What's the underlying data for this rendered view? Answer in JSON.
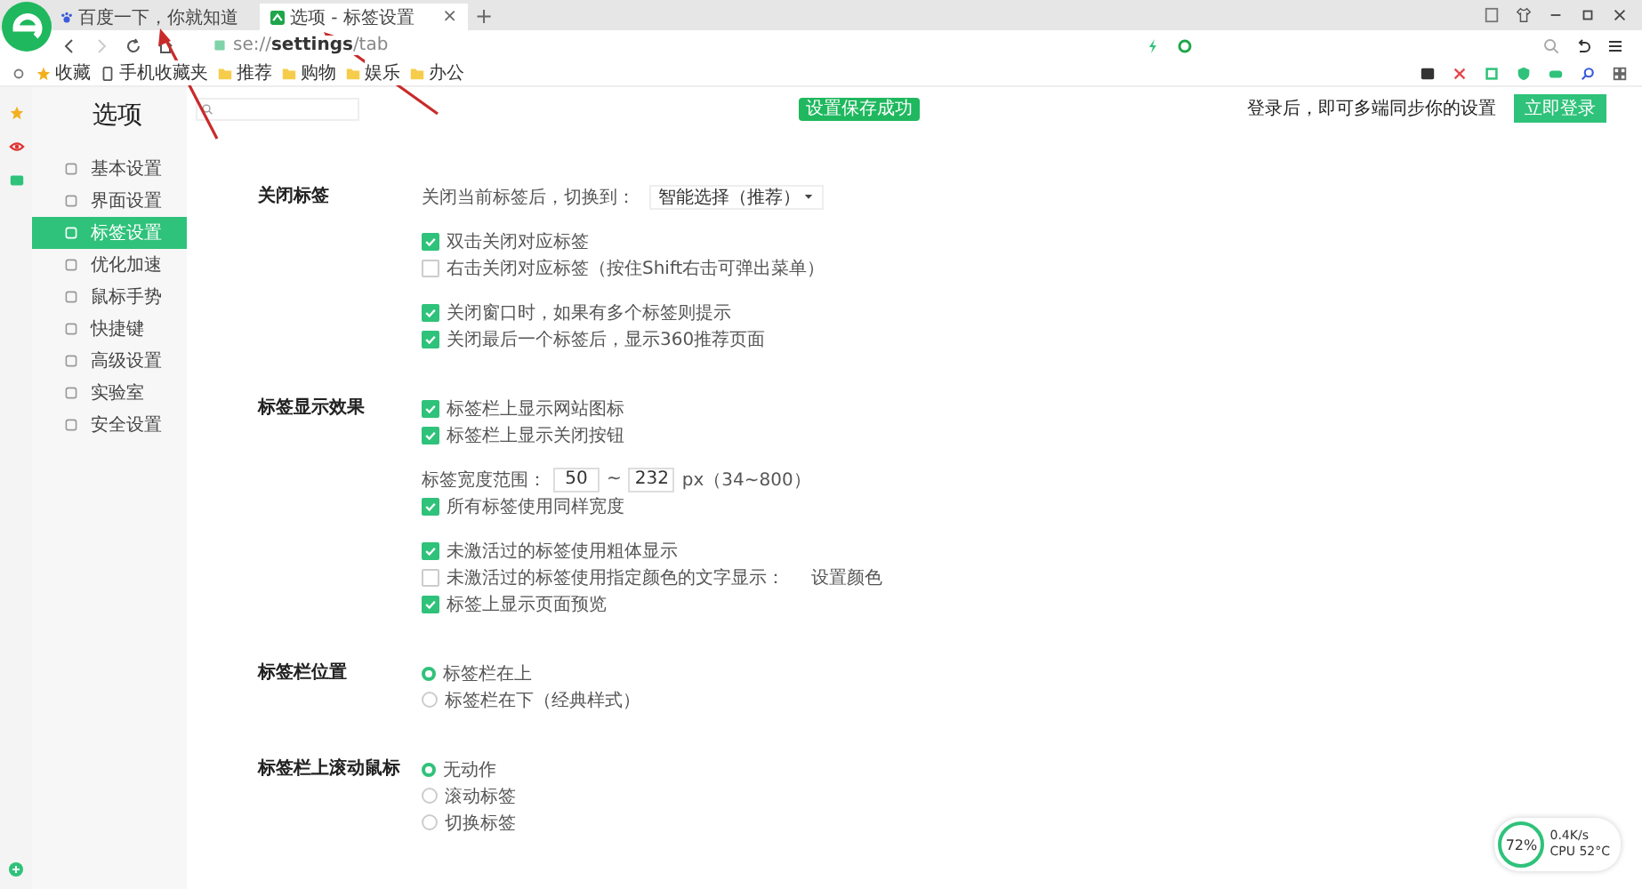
{
  "browser": {
    "tabs": [
      {
        "title": "百度一下，你就知道",
        "selected": false
      },
      {
        "title": "选项 - 标签设置",
        "selected": true
      }
    ],
    "tab_close": "×",
    "new_tab": "+",
    "address": "se://**settings**/tab",
    "bookmarks": [
      {
        "label": "收藏",
        "kind": "star"
      },
      {
        "label": "手机收藏夹",
        "kind": "phone"
      },
      {
        "label": "推荐",
        "kind": "folder"
      },
      {
        "label": "购物",
        "kind": "folder"
      },
      {
        "label": "娱乐",
        "kind": "folder"
      },
      {
        "label": "办公",
        "kind": "folder"
      }
    ]
  },
  "page": {
    "title": "选项",
    "toast": "设置保存成功",
    "sync_hint": "登录后，即可多端同步你的设置",
    "login_button": "立即登录"
  },
  "sidebar": {
    "items": [
      {
        "label": "基本设置",
        "selected": false
      },
      {
        "label": "界面设置",
        "selected": false
      },
      {
        "label": "标签设置",
        "selected": true
      },
      {
        "label": "优化加速",
        "selected": false
      },
      {
        "label": "鼠标手势",
        "selected": false
      },
      {
        "label": "快捷键",
        "selected": false
      },
      {
        "label": "高级设置",
        "selected": false
      },
      {
        "label": "实验室",
        "selected": false
      },
      {
        "label": "安全设置",
        "selected": false
      }
    ]
  },
  "sections": [
    {
      "title": "关闭标签",
      "groups": [
        [
          {
            "kind": "select",
            "label": "关闭当前标签后，切换到：",
            "value": "智能选择（推荐）"
          }
        ],
        [
          {
            "kind": "checkbox",
            "label": "双击关闭对应标签",
            "checked": true
          },
          {
            "kind": "checkbox",
            "label": "右击关闭对应标签（按住Shift右击可弹出菜单）",
            "checked": false
          }
        ],
        [
          {
            "kind": "checkbox",
            "label": "关闭窗口时，如果有多个标签则提示",
            "checked": true
          },
          {
            "kind": "checkbox",
            "label": "关闭最后一个标签后，显示360推荐页面",
            "checked": true
          }
        ]
      ]
    },
    {
      "title": "标签显示效果",
      "groups": [
        [
          {
            "kind": "checkbox",
            "label": "标签栏上显示网站图标",
            "checked": true
          },
          {
            "kind": "checkbox",
            "label": "标签栏上显示关闭按钮",
            "checked": true
          }
        ],
        [
          {
            "kind": "range",
            "label": "标签宽度范围：",
            "from": "50",
            "sep": "~",
            "to": "232",
            "unit": "px（34~800）"
          },
          {
            "kind": "checkbox",
            "label": "所有标签使用同样宽度",
            "checked": true
          }
        ],
        [
          {
            "kind": "checkbox",
            "label": "未激活过的标签使用粗体显示",
            "checked": true
          },
          {
            "kind": "checkbox",
            "label": "未激活过的标签使用指定颜色的文字显示：",
            "checked": false,
            "button": "设置颜色"
          },
          {
            "kind": "checkbox",
            "label": "标签上显示页面预览",
            "checked": true
          }
        ]
      ]
    },
    {
      "title": "标签栏位置",
      "groups": [
        [
          {
            "kind": "radio",
            "label": "标签栏在上",
            "selected": true
          },
          {
            "kind": "radio",
            "label": "标签栏在下（经典样式）",
            "selected": false
          }
        ]
      ]
    },
    {
      "title": "标签栏上滚动鼠标",
      "groups": [
        [
          {
            "kind": "radio",
            "label": "无动作",
            "selected": true
          },
          {
            "kind": "radio",
            "label": "滚动标签",
            "selected": false
          },
          {
            "kind": "radio",
            "label": "切换标签",
            "selected": false
          }
        ]
      ]
    }
  ],
  "monitor": {
    "percent": "72%",
    "speed": "0.4K/s",
    "cpu": "CPU 52°C"
  }
}
